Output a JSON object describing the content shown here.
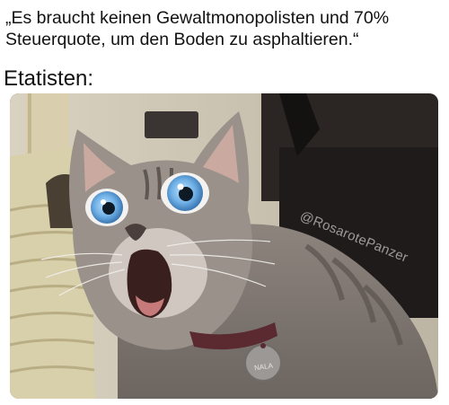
{
  "caption": {
    "quote_line1": "„Es braucht keinen Gewaltmonopolisten und 70%",
    "quote_line2": "Steuerquote, um den Boden zu asphaltieren.“",
    "subject": "Etatisten:"
  },
  "image": {
    "watermark": "@RosarotePanzer",
    "collar_tag": "NALA"
  }
}
